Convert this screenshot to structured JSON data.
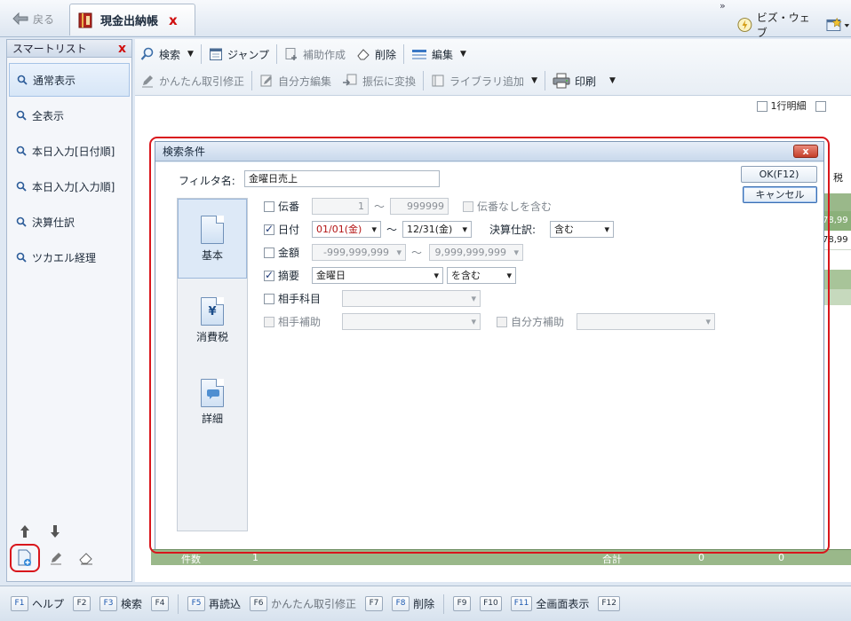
{
  "titlebar": {
    "back_label": "戻る",
    "doc_tab_label": "現金出納帳",
    "doc_tab_close": "x",
    "biz_web_label": "ビズ・ウェブ",
    "overflow": "»"
  },
  "sidebar": {
    "title": "スマートリスト",
    "close": "x",
    "items": [
      {
        "label": "通常表示"
      },
      {
        "label": "全表示"
      },
      {
        "label": "本日入力[日付順]"
      },
      {
        "label": "本日入力[入力順]"
      },
      {
        "label": "決算仕訳"
      },
      {
        "label": "ツカエル経理"
      }
    ]
  },
  "toolbar": {
    "row1": {
      "search": "検索",
      "jump": "ジャンプ",
      "aux_create": "補助作成",
      "delete": "削除",
      "edit": "編集"
    },
    "row2": {
      "easy_fix": "かんたん取引修正",
      "self_edit": "自分方編集",
      "convert": "振伝に変換",
      "library_add": "ライブラリ追加",
      "print": "印刷"
    }
  },
  "content": {
    "one_line_detail": "1行明細",
    "tax_label": "税",
    "grid_value_1": "78,99",
    "grid_value_2": "78,99",
    "footer": {
      "count_label": "件数",
      "count_value": "1",
      "total_label": "合計",
      "total_value_1": "0",
      "total_value_2": "0"
    }
  },
  "dialog": {
    "title": "検索条件",
    "close": "x",
    "filter_label": "フィルタ名:",
    "filter_value": "金曜日売上",
    "ok_label": "OK(F12)",
    "cancel_label": "キャンセル",
    "tabs": [
      {
        "label": "基本"
      },
      {
        "label": "消費税",
        "glyph": "¥"
      },
      {
        "label": "詳細"
      }
    ],
    "conditions": {
      "slip": {
        "label": "伝番",
        "from": "1",
        "tilde": "～",
        "to": "999999",
        "include_none": "伝番なしを含む"
      },
      "date": {
        "label": "日付",
        "from": "01/01(金)",
        "tilde": "～",
        "to": "12/31(金)",
        "closing_label": "決算仕訳:",
        "closing_value": "含む"
      },
      "amount": {
        "label": "金額",
        "from": "-999,999,999",
        "tilde": "～",
        "to": "9,999,999,999"
      },
      "summary": {
        "label": "摘要",
        "value": "金曜日",
        "mode": "を含む"
      },
      "account": {
        "label": "相手科目"
      },
      "sub": {
        "label": "相手補助",
        "self_label": "自分方補助"
      }
    }
  },
  "fkeys": [
    {
      "key": "F1",
      "label": "ヘルプ"
    },
    {
      "key": "F2",
      "label": ""
    },
    {
      "key": "F3",
      "label": "検索"
    },
    {
      "key": "F4",
      "label": ""
    },
    {
      "key": "F5",
      "label": "再読込"
    },
    {
      "key": "F6",
      "label": "かんたん取引修正"
    },
    {
      "key": "F7",
      "label": ""
    },
    {
      "key": "F8",
      "label": "削除"
    },
    {
      "key": "F9",
      "label": ""
    },
    {
      "key": "F10",
      "label": ""
    },
    {
      "key": "F11",
      "label": "全画面表示"
    },
    {
      "key": "F12",
      "label": ""
    }
  ],
  "colors": {
    "accent": "#1b58b0",
    "highlight": "#d9161c",
    "footer_green": "#9ab88a",
    "close_red": "#c5402b"
  }
}
